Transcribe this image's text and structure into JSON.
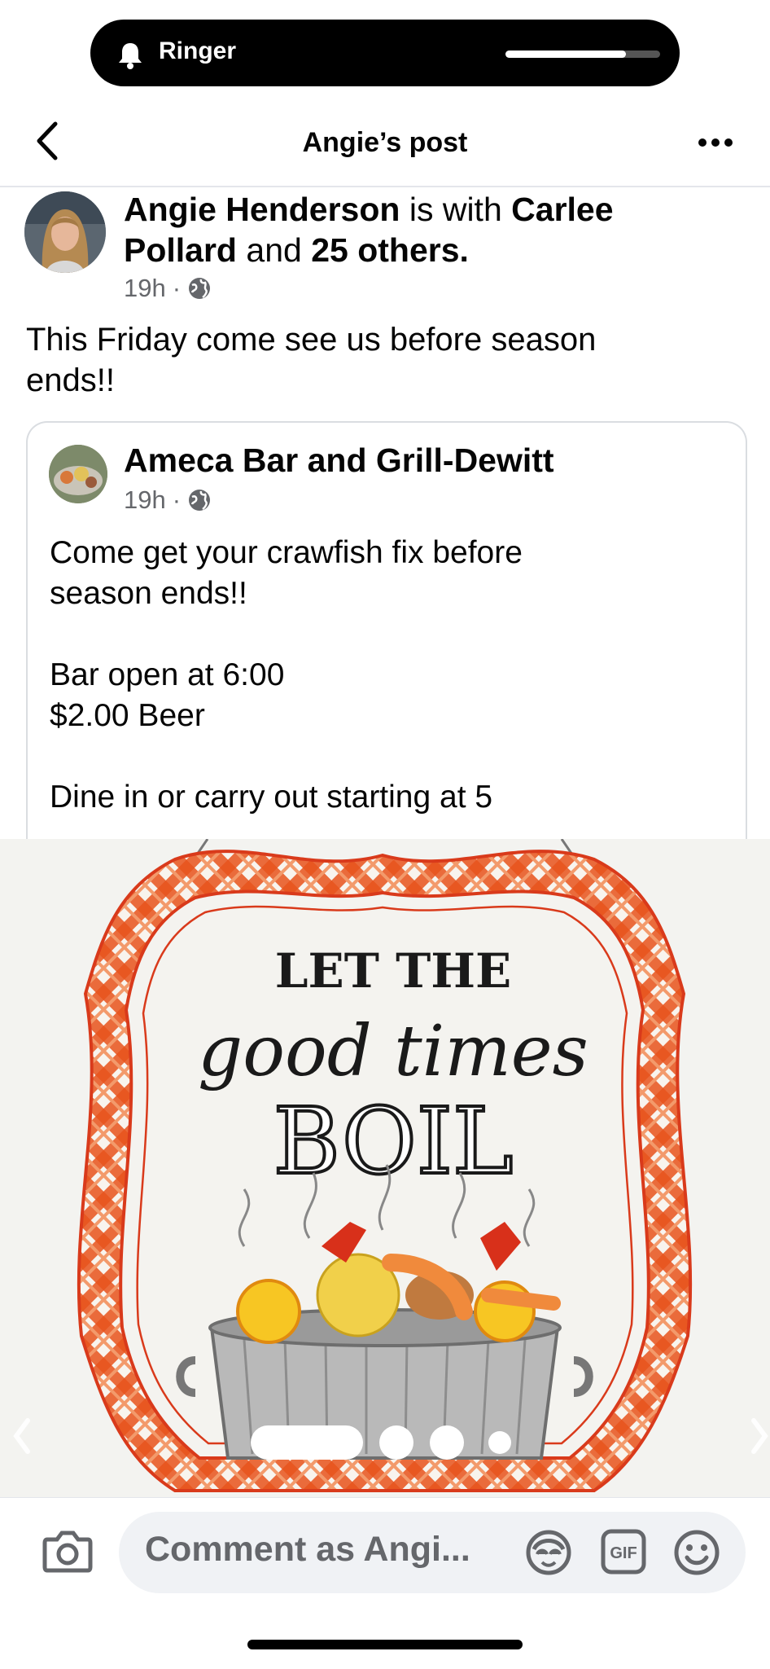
{
  "status_bar": {
    "ringer_label": "Ringer",
    "volume_level": 0.78
  },
  "header": {
    "title": "Angie’s post"
  },
  "post": {
    "author": "Angie Henderson",
    "with_text": "is with",
    "tagged": "Carlee Pollard",
    "and_text": "and",
    "others": "25 others.",
    "time": "19h",
    "separator": "·",
    "text_lines": [
      "This Friday come see us before season",
      "ends!!"
    ]
  },
  "shared": {
    "page_name": "Ameca Bar and Grill-Dewitt",
    "time": "19h",
    "separator": "·",
    "lines": [
      "Come get your crawfish fix before",
      "season ends!!",
      "",
      "Bar open at 6:00",
      "$2.00 Beer",
      "",
      "Dine in or carry out starting at 5"
    ]
  },
  "image": {
    "line1": "LET THE",
    "line2": "good times",
    "line3": "BOIL",
    "carousel_pages": 4,
    "carousel_active": 1
  },
  "comment": {
    "placeholder": "Comment as Angi..."
  },
  "icons": {
    "bell": "bell-icon",
    "back": "chevron-left-icon",
    "more": "more-dots-icon",
    "globe": "globe-icon",
    "camera": "camera-icon",
    "avatar": "avatar-sticker-icon",
    "gif": "gif-icon",
    "emoji": "emoji-icon"
  },
  "colors": {
    "accent_orange": "#e8541c",
    "plaid_red": "#d93a1b",
    "muted_text": "#65676b"
  }
}
